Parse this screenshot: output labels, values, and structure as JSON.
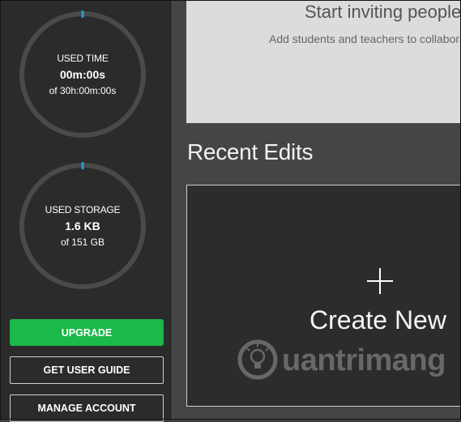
{
  "sidebar": {
    "time_gauge": {
      "title": "USED TIME",
      "value": "00m:00s",
      "total": "of 30h:00m:00s",
      "fraction_used": 0.0
    },
    "storage_gauge": {
      "title": "USED STORAGE",
      "value": "1.6 KB",
      "total": "of 151 GB",
      "fraction_used": 0.0
    },
    "buttons": {
      "upgrade": "UPGRADE",
      "user_guide": "GET USER GUIDE",
      "manage_account": "MANAGE ACCOUNT"
    }
  },
  "main": {
    "invite": {
      "title": "Start inviting people",
      "subtitle": "Add students and teachers to collaborate"
    },
    "recent_edits_title": "Recent Edits",
    "create_new": {
      "label": "Create New",
      "icon": "plus-icon"
    }
  },
  "watermark": {
    "text": "uantrimang",
    "icon": "lightbulb-logo"
  },
  "colors": {
    "accent_green": "#1bb84a",
    "gauge_track": "#4a4a4a",
    "gauge_marker": "#2a9ad6",
    "sidebar_bg": "#2b2b2b"
  }
}
